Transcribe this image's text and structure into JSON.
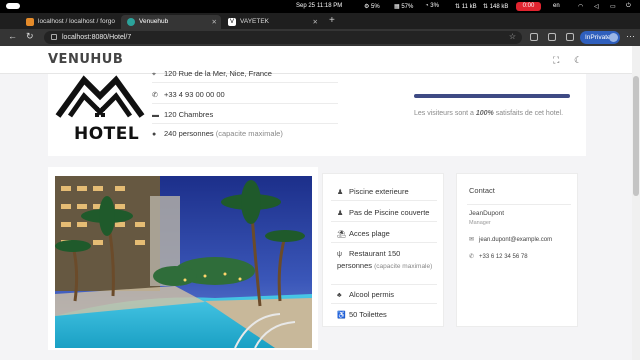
{
  "os_bar": {
    "date": "Sep 25",
    "time": "11:18 PM",
    "cpu": "5%",
    "mem": "57%",
    "gpu": "3%",
    "net_up": "11 kB",
    "net_down": "148 kB",
    "rec_label": "0:00",
    "lang": "en"
  },
  "tabs": [
    {
      "label": "localhost / localhost / forgo",
      "active": false
    },
    {
      "label": "Venuehub",
      "active": true
    },
    {
      "label": "VAYETEK",
      "active": false
    }
  ],
  "address_bar": {
    "url": "localhost:8080/Hotel/7",
    "profile": "InPrivate"
  },
  "header": {
    "brand": "VENUHUB"
  },
  "hotel": {
    "logo_text": "HOTEL",
    "address": "120 Rue de la Mer, Nice, France",
    "phone": "+33 4 93 00 00 00",
    "rooms": "120 Chambres",
    "capacity": "240 personnes",
    "capacity_note": "(capacite maximale)",
    "satisfaction_percent": 100,
    "satisfaction_prefix": "Les visiteurs sont a",
    "satisfaction_value": "100%",
    "satisfaction_suffix": "satisfaits de cet hotel."
  },
  "carousel": {
    "slides": 4,
    "active_slide": 0
  },
  "amenities": [
    {
      "icon": "person-icon",
      "label": "Piscine exterieure",
      "note": ""
    },
    {
      "icon": "no-pool-icon",
      "label": "Pas de Piscine couverte",
      "note": ""
    },
    {
      "icon": "beach-icon",
      "label": "Acces plage",
      "note": ""
    },
    {
      "icon": "restaurant-icon",
      "label": "Restaurant 150 personnes",
      "note": "(capacite maximale)"
    },
    {
      "icon": "bar-icon",
      "label": "Alcool permis",
      "note": ""
    },
    {
      "icon": "toilet-icon",
      "label": "50 Toilettes",
      "note": ""
    }
  ],
  "contact": {
    "title": "Contact",
    "name": "JeanDupont",
    "role": "Manager",
    "email": "jean.dupont@example.com",
    "phone": "+33 6 12 34 56 78"
  }
}
